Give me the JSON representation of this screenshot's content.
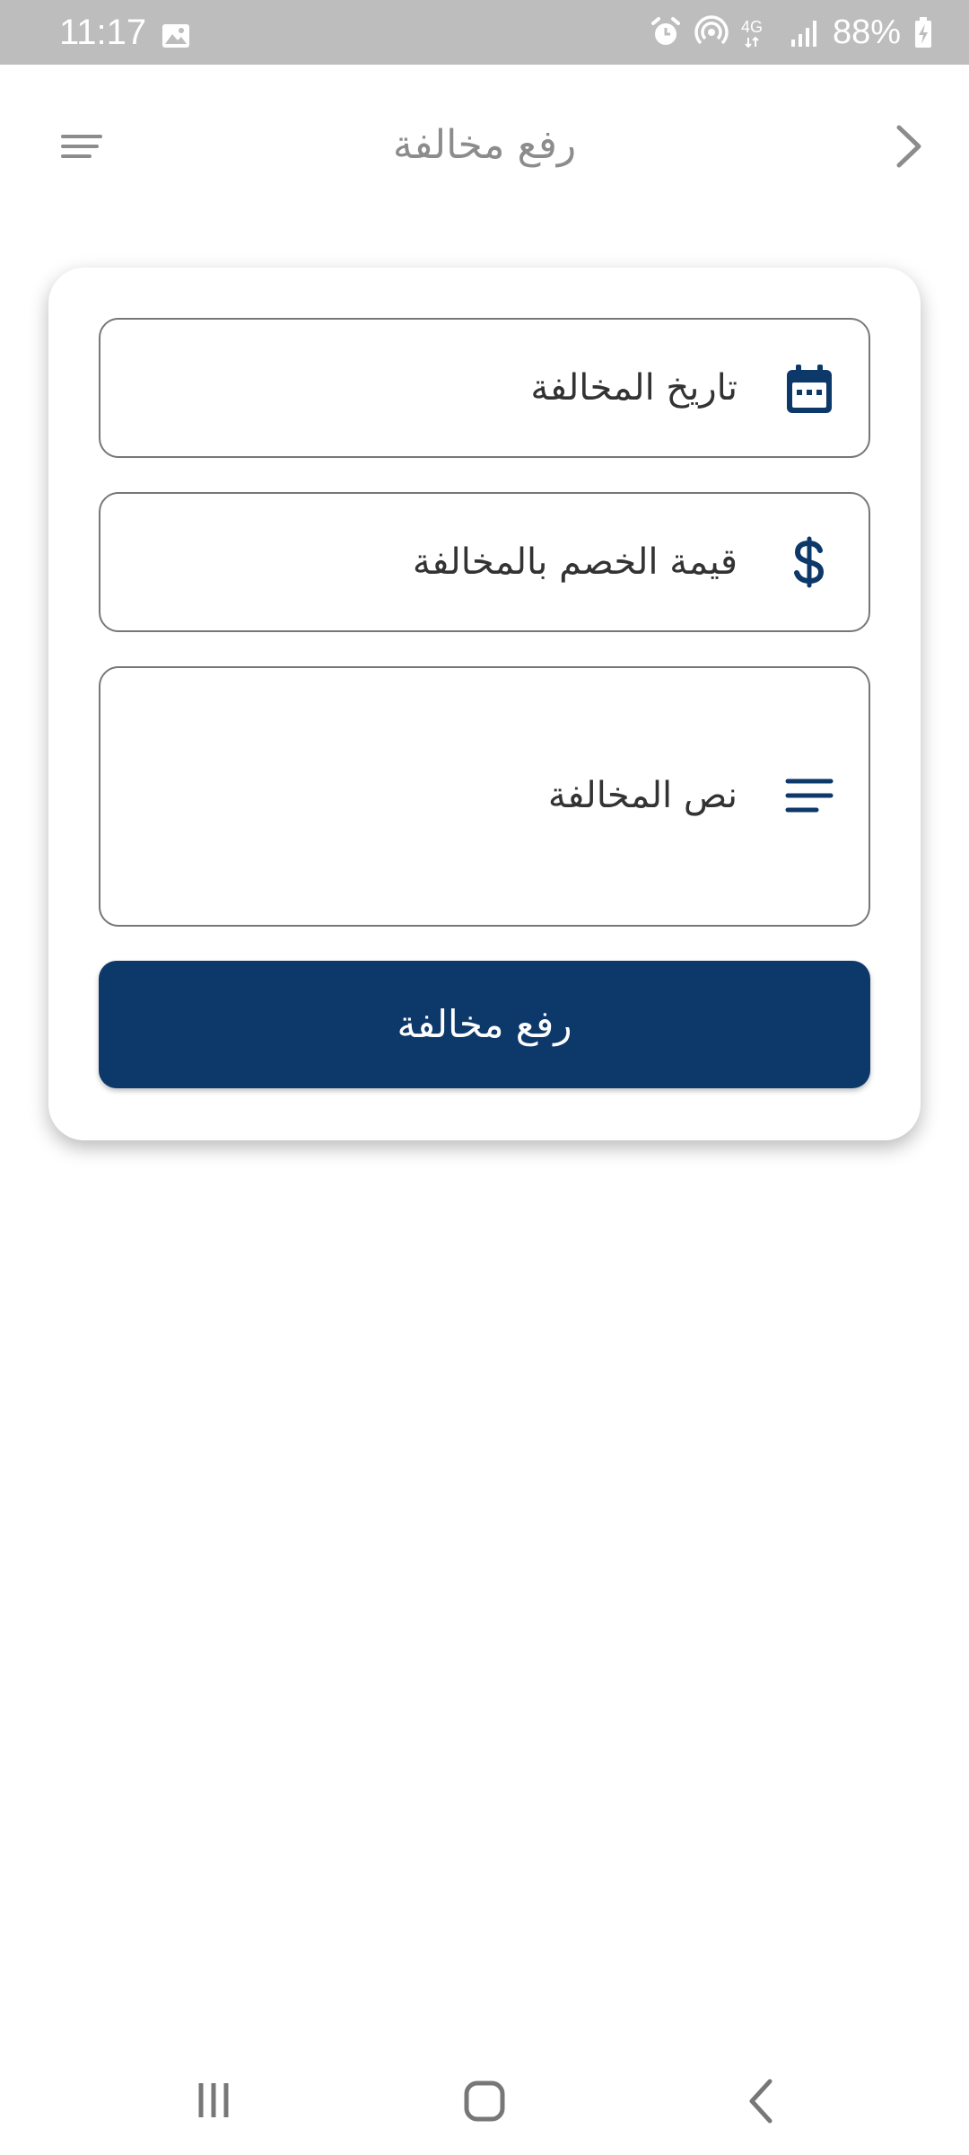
{
  "status_bar": {
    "time": "11:17",
    "network": "4G",
    "battery": "88%",
    "icons": [
      "gallery-icon",
      "alarm-icon",
      "hotspot-icon",
      "signal-icon",
      "battery-charging-icon"
    ]
  },
  "app_bar": {
    "title": "رفع مخالفة",
    "menu_icon": "menu-icon",
    "back_icon": "chevron-right-icon"
  },
  "form": {
    "date_field": {
      "label": "تاريخ المخالفة",
      "icon": "calendar-icon"
    },
    "amount_field": {
      "label": "قيمة الخصم بالمخالفة",
      "icon": "dollar-icon"
    },
    "text_field": {
      "label": "نص المخالفة",
      "icon": "text-lines-icon"
    },
    "submit_label": "رفع مخالفة"
  },
  "colors": {
    "primary": "#0d386a",
    "status_bar": "#bdbdbd",
    "title_gray": "#8c8c8c",
    "field_border": "#777777"
  },
  "nav_bar": {
    "icons": [
      "recents-icon",
      "home-icon",
      "back-icon"
    ]
  }
}
